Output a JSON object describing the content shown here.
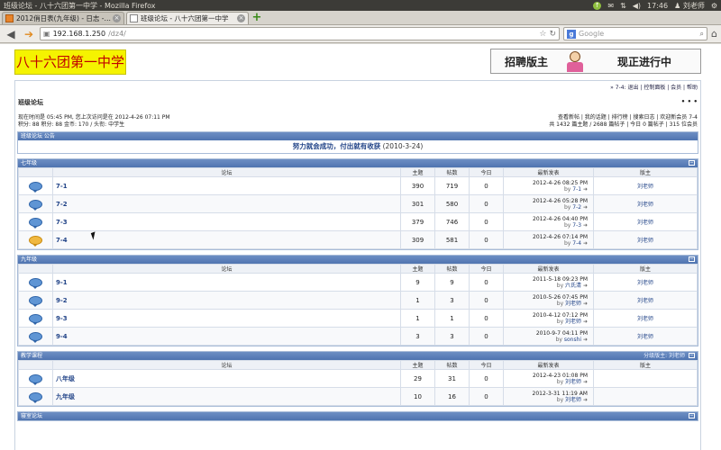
{
  "window": {
    "title": "班级论坛 - 八十六团第一中学 - Mozilla Firefox"
  },
  "tray": {
    "time": "17:46",
    "user": "刘老师"
  },
  "tabs": [
    {
      "label": "2012俏日表(九年级) - 日志 - ..."
    },
    {
      "label": "班级论坛 - 八十六团第一中学"
    }
  ],
  "nav": {
    "url_host": "192.168.1.250",
    "url_path": "/dz4/",
    "search_placeholder": "Google"
  },
  "banner": {
    "logo": "八十六团第一中学",
    "ad_left": "招聘版主",
    "ad_right": "现正进行中"
  },
  "userlinks": "» 7-4: 退出 | 控制面板 | 会员 | 帮助",
  "crumb": {
    "title": "班级论坛",
    "dots": "• • •"
  },
  "info": {
    "left1": "现在时间是 05:45 PM, 您上次访问是在 2012-4-26 07:11 PM",
    "left2": "积分: 88  积分: 88  金币: 170  / 头衔: 中学生",
    "right1": "查看新帖 | 我的话题 | 排行榜 | 搜索日志 | 欢迎新会员 7-4",
    "right2": "共 1432 篇主题 / 2688 篇帖子 | 今日 0 篇帖子 | 315 位会员"
  },
  "announce": {
    "head": "班级论坛 公告",
    "text": "努力就会成功，付出就有收获",
    "date": "(2010-3-24)"
  },
  "columns": {
    "forum": "论坛",
    "topics": "主题",
    "posts": "帖数",
    "today": "今日",
    "last": "最新发表",
    "mod": "版主"
  },
  "sections": [
    {
      "name": "七年级",
      "moderator_label": "",
      "rows": [
        {
          "name": "7-1",
          "topics": "390",
          "posts": "719",
          "today": "0",
          "date": "2012-4-26 08:25 PM",
          "by": "7-1",
          "mod": "刘老师",
          "hot": false
        },
        {
          "name": "7-2",
          "topics": "301",
          "posts": "580",
          "today": "0",
          "date": "2012-4-26 05:28 PM",
          "by": "7-2",
          "mod": "刘老师",
          "hot": false
        },
        {
          "name": "7-3",
          "topics": "379",
          "posts": "746",
          "today": "0",
          "date": "2012-4-26 04:40 PM",
          "by": "7-3",
          "mod": "刘老师",
          "hot": false
        },
        {
          "name": "7-4",
          "topics": "309",
          "posts": "581",
          "today": "0",
          "date": "2012-4-26 07:14 PM",
          "by": "7-4",
          "mod": "刘老师",
          "hot": true
        }
      ]
    },
    {
      "name": "九年级",
      "moderator_label": "",
      "rows": [
        {
          "name": "9-1",
          "topics": "9",
          "posts": "9",
          "today": "0",
          "date": "2011-5-18 09:23 PM",
          "by": "六氏清",
          "mod": "刘老师",
          "hot": false
        },
        {
          "name": "9-2",
          "topics": "1",
          "posts": "3",
          "today": "0",
          "date": "2010-5-26 07:45 PM",
          "by": "刘老师",
          "mod": "刘老师",
          "hot": false
        },
        {
          "name": "9-3",
          "topics": "1",
          "posts": "1",
          "today": "0",
          "date": "2010-4-12 07:12 PM",
          "by": "刘老师",
          "mod": "刘老师",
          "hot": false
        },
        {
          "name": "9-4",
          "topics": "3",
          "posts": "3",
          "today": "0",
          "date": "2010-9-7 04:11 PM",
          "by": "sonshi",
          "mod": "刘老师",
          "hot": false
        }
      ]
    },
    {
      "name": "教学课程",
      "moderator_label": "分级版主: 刘老师",
      "rows": [
        {
          "name": "八年级",
          "topics": "29",
          "posts": "31",
          "today": "0",
          "date": "2012-4-23 01:08 PM",
          "by": "刘老师",
          "mod": "",
          "hot": false
        },
        {
          "name": "九年级",
          "topics": "10",
          "posts": "16",
          "today": "0",
          "date": "2012-3-31 11:19 AM",
          "by": "刘老师",
          "mod": "",
          "hot": false
        }
      ]
    },
    {
      "name": "寝室论坛",
      "moderator_label": "",
      "rows": []
    }
  ],
  "labels": {
    "by": "by"
  }
}
